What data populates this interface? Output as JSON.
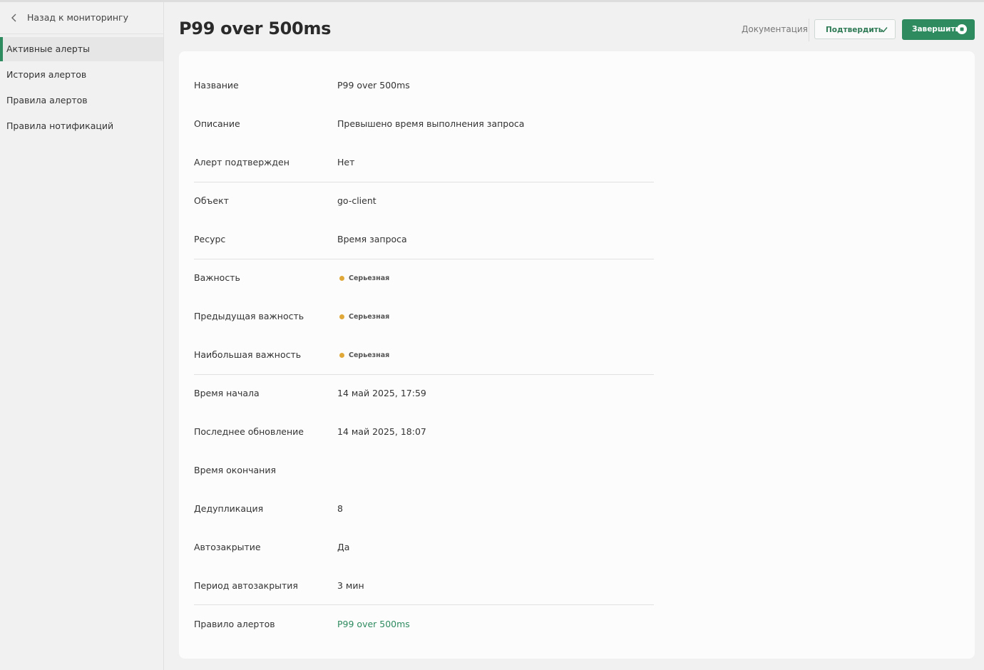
{
  "sidebar": {
    "back_label": "Назад к мониторингу",
    "items": [
      {
        "label": "Активные алерты",
        "active": true
      },
      {
        "label": "История алертов",
        "active": false
      },
      {
        "label": "Правила алертов",
        "active": false
      },
      {
        "label": "Правила нотификаций",
        "active": false
      }
    ]
  },
  "header": {
    "title": "P99 over 500ms",
    "docs_label": "Документация",
    "confirm_label": "Подтвердить",
    "finish_label": "Завершить"
  },
  "colors": {
    "accent": "#2e8b60",
    "severity_dot": "#e0a838"
  },
  "details": {
    "name": {
      "key": "Название",
      "value": "P99 over 500ms"
    },
    "description": {
      "key": "Описание",
      "value": "Превышено время выполнения запроса"
    },
    "acknowledged": {
      "key": "Алерт подтвержден",
      "value": "Нет"
    },
    "object": {
      "key": "Объект",
      "value": "go-client"
    },
    "resource": {
      "key": "Ресурс",
      "value": "Время запроса"
    },
    "severity": {
      "key": "Важность",
      "value": "Серьезная"
    },
    "prev_severity": {
      "key": "Предыдущая важность",
      "value": "Серьезная"
    },
    "max_severity": {
      "key": "Наибольшая важность",
      "value": "Серьезная"
    },
    "start_time": {
      "key": "Время начала",
      "value": "14 май 2025, 17:59"
    },
    "last_update": {
      "key": "Последнее обновление",
      "value": "14 май 2025, 18:07"
    },
    "end_time": {
      "key": "Время окончания",
      "value": ""
    },
    "deduplication": {
      "key": "Дедупликация",
      "value": "8"
    },
    "autoclose": {
      "key": "Автозакрытие",
      "value": "Да"
    },
    "autoclose_period": {
      "key": "Период автозакрытия",
      "value": "3 мин"
    },
    "alert_rule": {
      "key": "Правило алертов",
      "value": "P99 over 500ms"
    }
  }
}
